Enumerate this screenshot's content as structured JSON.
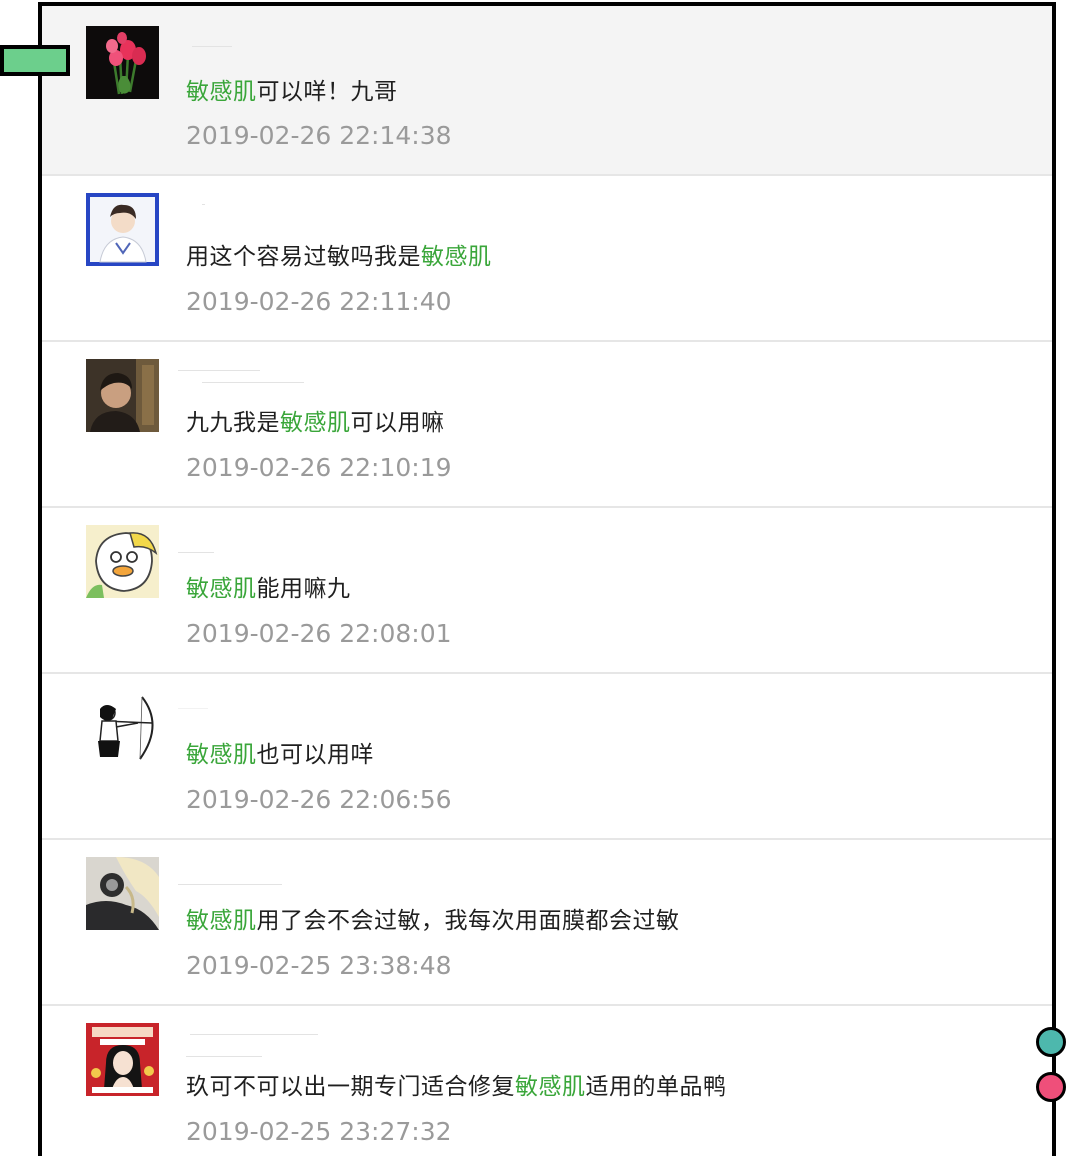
{
  "highlight_word": "敏感肌",
  "colors": {
    "highlight": "#3aa63a",
    "timestamp": "#9a9a9a",
    "bookmark_tab": "#6ccf8c",
    "dot_teal": "#4db8ad",
    "dot_pink": "#ef4f7a"
  },
  "comments": [
    {
      "avatar_icon": "red-tulips-avatar",
      "before": "",
      "keyword": "敏感肌",
      "after": "可以咩！九哥",
      "time": "2019-02-26 22:14:38"
    },
    {
      "avatar_icon": "person-portrait-blue-frame-avatar",
      "before": "用这个容易过敏吗我是",
      "keyword": "敏感肌",
      "after": "",
      "time": "2019-02-26 22:11:40"
    },
    {
      "avatar_icon": "dark-photo-person-avatar",
      "before": "九九我是",
      "keyword": "敏感肌",
      "after": "可以用嘛",
      "time": "2019-02-26 22:10:19"
    },
    {
      "avatar_icon": "cartoon-duck-avatar",
      "before": "",
      "keyword": "敏感肌",
      "after": "能用嘛九",
      "time": "2019-02-26 22:08:01"
    },
    {
      "avatar_icon": "archer-girl-sketch-avatar",
      "before": "",
      "keyword": "敏感肌",
      "after": "也可以用咩",
      "time": "2019-02-26 22:06:56"
    },
    {
      "avatar_icon": "blonde-anime-character-avatar",
      "before": "",
      "keyword": "敏感肌",
      "after": "用了会不会过敏，我每次用面膜都会过敏",
      "time": "2019-02-25 23:38:48"
    },
    {
      "avatar_icon": "red-poster-girl-avatar",
      "before": "玖可不可以出一期专门适合修复",
      "keyword": "敏感肌",
      "after": "适用的单品鸭",
      "time": "2019-02-25 23:27:32"
    }
  ]
}
